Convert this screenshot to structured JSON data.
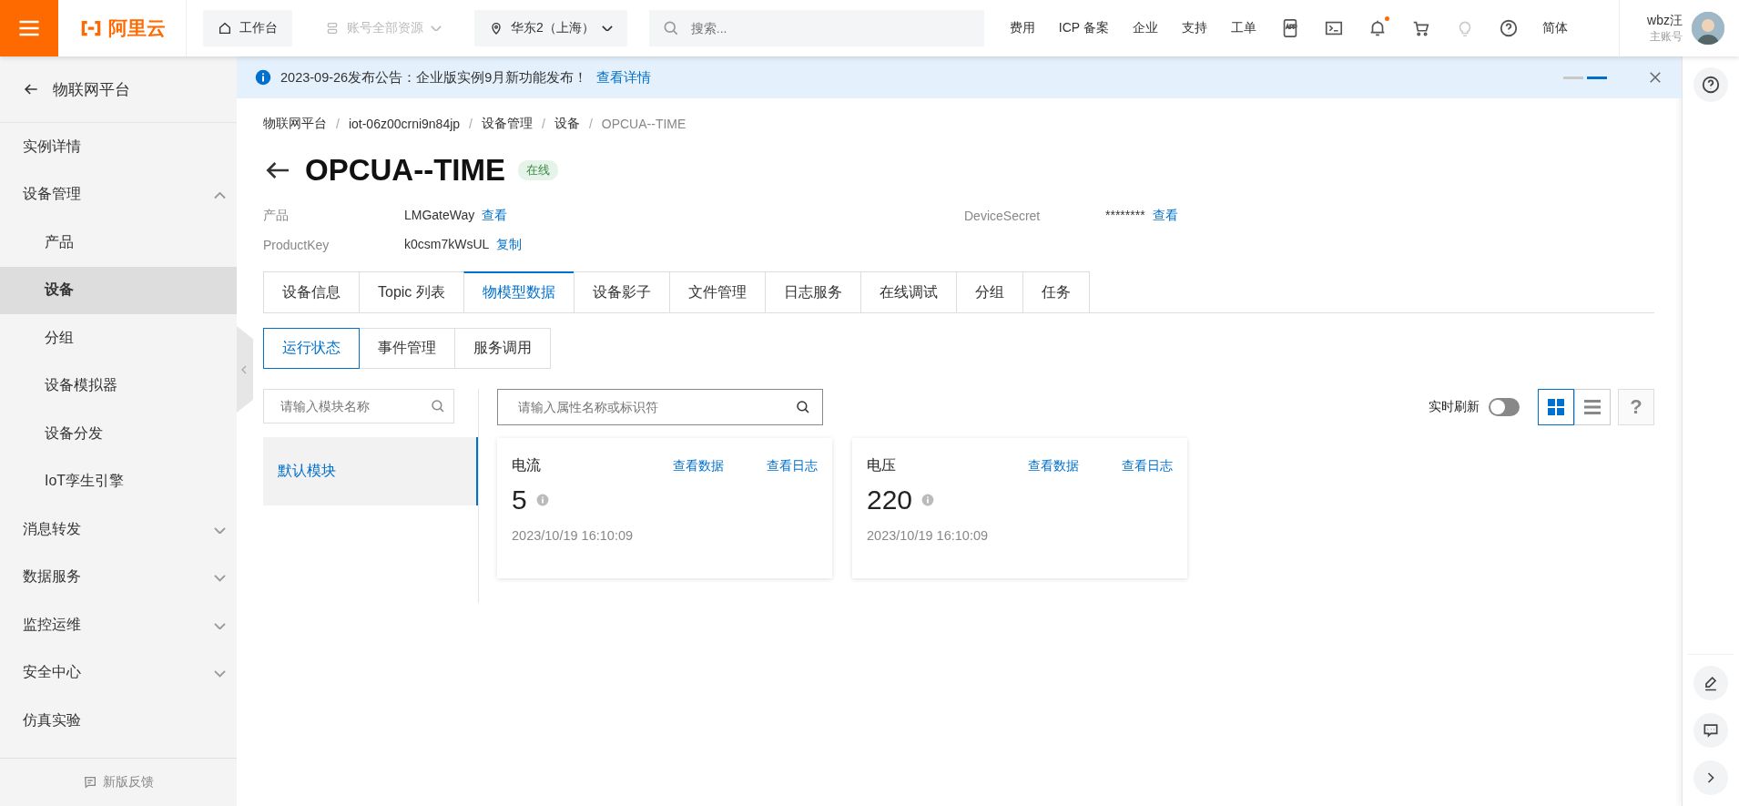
{
  "topbar": {
    "logo": "阿里云",
    "nav": [
      {
        "label": "工作台",
        "kind": "home",
        "disabled": false
      },
      {
        "label": "账号全部资源",
        "kind": "resources",
        "disabled": true
      },
      {
        "label": "华东2（上海）",
        "kind": "region",
        "disabled": false
      }
    ],
    "search": {
      "placeholder": "搜索..."
    },
    "links": [
      "费用",
      "ICP 备案",
      "企业",
      "支持",
      "工单"
    ],
    "bell_badge": true,
    "language": "简体",
    "user": {
      "name": "wbz汪",
      "role": "主账号"
    }
  },
  "sidebar": {
    "back": "物联网平台",
    "items": [
      {
        "label": "实例详情",
        "selected": false
      },
      {
        "label": "设备管理",
        "selected": false,
        "expanded": true,
        "children": [
          {
            "label": "产品",
            "selected": false
          },
          {
            "label": "设备",
            "selected": true
          },
          {
            "label": "分组",
            "selected": false
          },
          {
            "label": "设备模拟器",
            "selected": false
          },
          {
            "label": "设备分发",
            "selected": false
          },
          {
            "label": "IoT孪生引擎",
            "selected": false
          }
        ]
      },
      {
        "label": "消息转发",
        "selected": false,
        "expanded": false
      },
      {
        "label": "数据服务",
        "selected": false,
        "expanded": false
      },
      {
        "label": "监控运维",
        "selected": false,
        "expanded": false
      },
      {
        "label": "安全中心",
        "selected": false,
        "expanded": false
      },
      {
        "label": "仿真实验",
        "selected": false
      }
    ],
    "feedback": "新版反馈"
  },
  "notice": {
    "text": "2023-09-26发布公告：企业版实例9月新功能发布！",
    "link": "查看详情",
    "pages": [
      {
        "selected": false
      },
      {
        "selected": true
      }
    ]
  },
  "breadcrumb": [
    {
      "label": "物联网平台"
    },
    {
      "separator": "/",
      "label": "iot-06z00crni9n84jp"
    },
    {
      "separator": "/",
      "label": "设备管理"
    },
    {
      "separator": "/",
      "label": "设备"
    },
    {
      "separator": "/",
      "label": "OPCUA--TIME"
    }
  ],
  "device": {
    "title": "OPCUA--TIME",
    "status": "在线",
    "fields": [
      {
        "label": "产品",
        "value": "LMGateWay",
        "link": "查看"
      },
      {
        "label": "DeviceSecret",
        "value": "********",
        "link": "查看"
      },
      {
        "label": "ProductKey",
        "value": "k0csm7kWsUL",
        "link": "复制"
      }
    ]
  },
  "tabs": [
    {
      "label": "设备信息",
      "selected": false
    },
    {
      "label": "Topic 列表",
      "selected": false
    },
    {
      "label": "物模型数据",
      "selected": true
    },
    {
      "label": "设备影子",
      "selected": false
    },
    {
      "label": "文件管理",
      "selected": false
    },
    {
      "label": "日志服务",
      "selected": false
    },
    {
      "label": "在线调试",
      "selected": false
    },
    {
      "label": "分组",
      "selected": false
    },
    {
      "label": "任务",
      "selected": false
    }
  ],
  "subtabs": [
    {
      "label": "运行状态",
      "selected": true
    },
    {
      "label": "事件管理",
      "selected": false
    },
    {
      "label": "服务调用",
      "selected": false
    }
  ],
  "module_search": {
    "placeholder": "请输入模块名称"
  },
  "modules": [
    {
      "label": "默认模块",
      "selected": true
    }
  ],
  "property_search": {
    "placeholder": "请输入属性名称或标识符"
  },
  "realtime_refresh": {
    "label": "实时刷新",
    "on": false
  },
  "view_modes": [
    {
      "kind": "grid",
      "selected": true
    },
    {
      "kind": "list",
      "selected": false
    }
  ],
  "help": "?",
  "cards": [
    {
      "name": "电流",
      "data_link": "查看数据",
      "log_link": "查看日志",
      "value": "5",
      "time": "2023/10/19 16:10:09"
    },
    {
      "name": "电压",
      "data_link": "查看数据",
      "log_link": "查看日志",
      "value": "220",
      "time": "2023/10/19 16:10:09"
    }
  ]
}
